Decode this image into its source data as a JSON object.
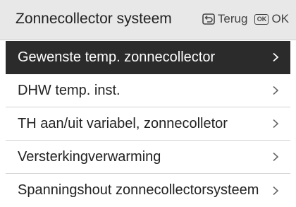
{
  "header": {
    "title": "Zonnecollector systeem",
    "back_label": "Terug",
    "back_icon": "back-arrow-icon",
    "ok_icon_text": "OK",
    "ok_label": "OK"
  },
  "menu": {
    "items": [
      {
        "label": "Gewenste temp. zonnecollector",
        "selected": true
      },
      {
        "label": "DHW temp. inst.",
        "selected": false
      },
      {
        "label": "TH aan/uit variabel, zonnecolletor",
        "selected": false
      },
      {
        "label": "Versterkingverwarming",
        "selected": false
      },
      {
        "label": "Spanningshout zonnecollectorsysteem",
        "selected": false
      }
    ]
  },
  "colors": {
    "header_bg": "#e8e8e8",
    "selected_bg": "#2b2b2b",
    "text": "#222222",
    "divider": "#d4d4d4"
  }
}
